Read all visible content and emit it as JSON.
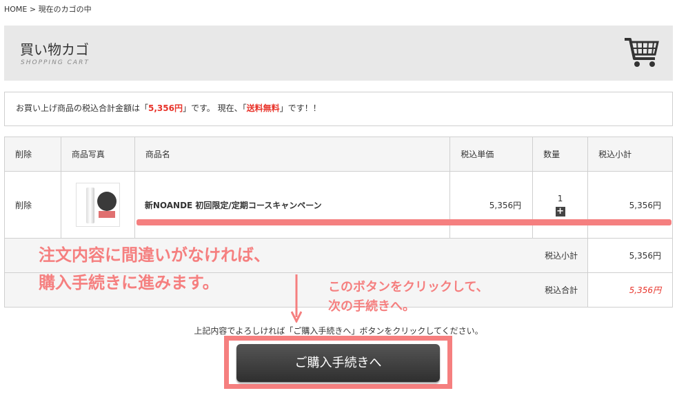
{
  "breadcrumb": {
    "home": "HOME",
    "sep": ">",
    "current": "現在のカゴの中"
  },
  "header": {
    "title": "買い物カゴ",
    "subtitle": "SHOPPING CART",
    "icon": "cart-icon"
  },
  "notice": {
    "prefix": "お買い上げ商品の税込合計金額は「",
    "amount": "5,356円",
    "middle": "」です。 現在、「",
    "shipping": "送料無料",
    "suffix": "」です！！"
  },
  "table": {
    "headers": [
      "削除",
      "商品写真",
      "商品名",
      "税込単価",
      "数量",
      "税込小計"
    ],
    "item": {
      "delete_label": "削除",
      "name": "新NOANDE 初回限定/定期コースキャンペーン",
      "price": "5,356円",
      "qty": "1",
      "subtotal": "5,356円"
    },
    "subtotal_label": "税込小計",
    "subtotal_value": "5,356円",
    "total_label": "税込合計",
    "total_value": "5,356円"
  },
  "annotations": {
    "note1_line1": "注文内容に間違いがなければ、",
    "note1_line2": "購入手続きに進みます。",
    "note2_line1": "このボタンをクリックして、",
    "note2_line2": "次の手続きへ。"
  },
  "confirm_text": "上記内容でよろしければ「ご購入手続きへ」ボタンをクリックしてください。",
  "buy_button": "ご購入手続きへ",
  "colors": {
    "accent": "#e8332a",
    "annotation": "#f57f7f",
    "button": "#3a3a3a"
  }
}
